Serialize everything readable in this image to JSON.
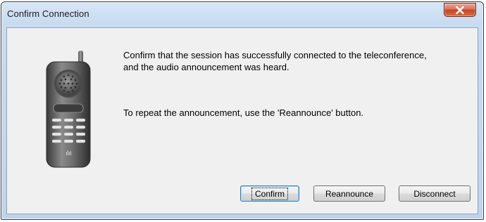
{
  "window": {
    "title": "Confirm Connection"
  },
  "message": {
    "paragraph1": "Confirm that the session has successfully connected to the teleconference, and the audio announcement was heard.",
    "paragraph2": "To repeat the announcement, use the 'Reannounce' button."
  },
  "buttons": {
    "confirm": "Confirm",
    "reannounce": "Reannounce",
    "disconnect": "Disconnect"
  },
  "icons": {
    "close": "close-icon",
    "phone": "mobile-phone-icon"
  },
  "colors": {
    "close_button": "#c3442a",
    "titlebar": "#c8dbf0",
    "client_background": "#f0f0f0"
  }
}
